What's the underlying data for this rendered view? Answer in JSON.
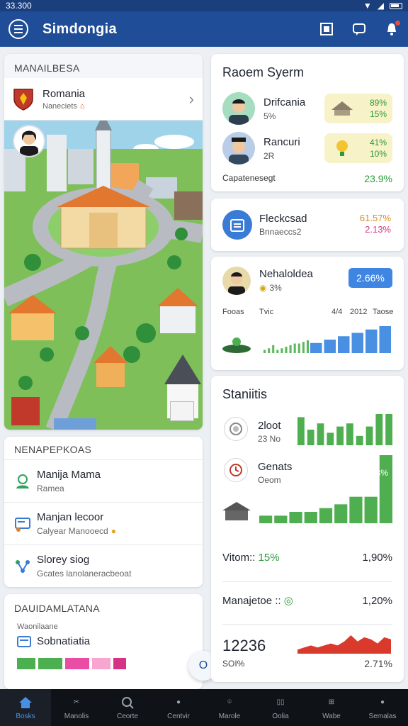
{
  "status": {
    "time": "33.300"
  },
  "app": {
    "title": "Simdongia"
  },
  "region": {
    "section_title": "MANAILBESA",
    "name": "Romania",
    "sub": "Naneciets"
  },
  "list": {
    "section_title": "NENAPEPKOAS",
    "items": [
      {
        "title": "Manija Mama",
        "sub": "Ramea"
      },
      {
        "title": "Manjan lecoor",
        "sub": "Calyear Manooecd"
      },
      {
        "title": "Slorey siog",
        "sub": "Gcates lanolaneracbeoat"
      }
    ]
  },
  "dashboard": {
    "section_title": "DAUIDAMLATANA",
    "label": "Waonilaane",
    "row_name": "Sobnatiatia"
  },
  "fab": {
    "label": "O"
  },
  "system": {
    "title": "Raoem Syerm",
    "rows": [
      {
        "name": "Drifcania",
        "sub": "5%",
        "v1": "89%",
        "v2": "15%"
      },
      {
        "name": "Rancuri",
        "sub": "2R",
        "v1": "41%",
        "v2": "10%"
      }
    ],
    "footer_label": "Capatenesegt",
    "footer_value": "23.9%"
  },
  "ready": {
    "title": "Fleckcsad",
    "sub": "Bnnaeccs2",
    "v1": "61.57%",
    "v2": "2.13%"
  },
  "manager": {
    "name": "Nehaloldea",
    "sub": "3%",
    "pill": "2.66%",
    "axis": [
      "Fooas",
      "Tvic",
      "4/4",
      "2012",
      "Taose"
    ]
  },
  "stats": {
    "title": "Staniitis",
    "items": [
      {
        "name": "2loot",
        "sub": "23 No"
      },
      {
        "name": "Genats",
        "sub": "Oeom",
        "value": "13%"
      }
    ],
    "lines": [
      {
        "label": "Vitom::",
        "pct": "15%",
        "value": "1,90%"
      },
      {
        "label": "Manajetoe ::",
        "value": "1,20%"
      }
    ],
    "big_number": "12236",
    "foot_label": "SOI%",
    "foot_value": "2.71%"
  },
  "chart_data": [
    {
      "type": "bar",
      "values": [
        2,
        3,
        5,
        2,
        3,
        4,
        5,
        6,
        6,
        7,
        8
      ],
      "color": "#5cb85c"
    },
    {
      "type": "bar",
      "values": [
        3,
        4,
        5,
        6,
        7,
        8
      ],
      "color": "#4a90e2"
    },
    {
      "type": "bar",
      "values": [
        9,
        5,
        7,
        4,
        6,
        7,
        3,
        6,
        10,
        10
      ],
      "color": "#4fae4f"
    },
    {
      "type": "bar",
      "values": [
        2,
        2,
        3,
        3,
        4,
        5,
        7,
        7,
        18
      ],
      "color": "#4fae4f"
    },
    {
      "type": "area",
      "values": [
        2,
        3,
        4,
        3,
        4,
        5,
        4,
        6,
        9,
        6,
        8,
        7,
        5,
        8,
        7
      ],
      "color": "#d93a2b"
    }
  ],
  "nav": [
    "Bosks",
    "Manolis",
    "Ceorte",
    "Centvir",
    "Marole",
    "Oolia",
    "Wabe",
    "Semalas"
  ]
}
